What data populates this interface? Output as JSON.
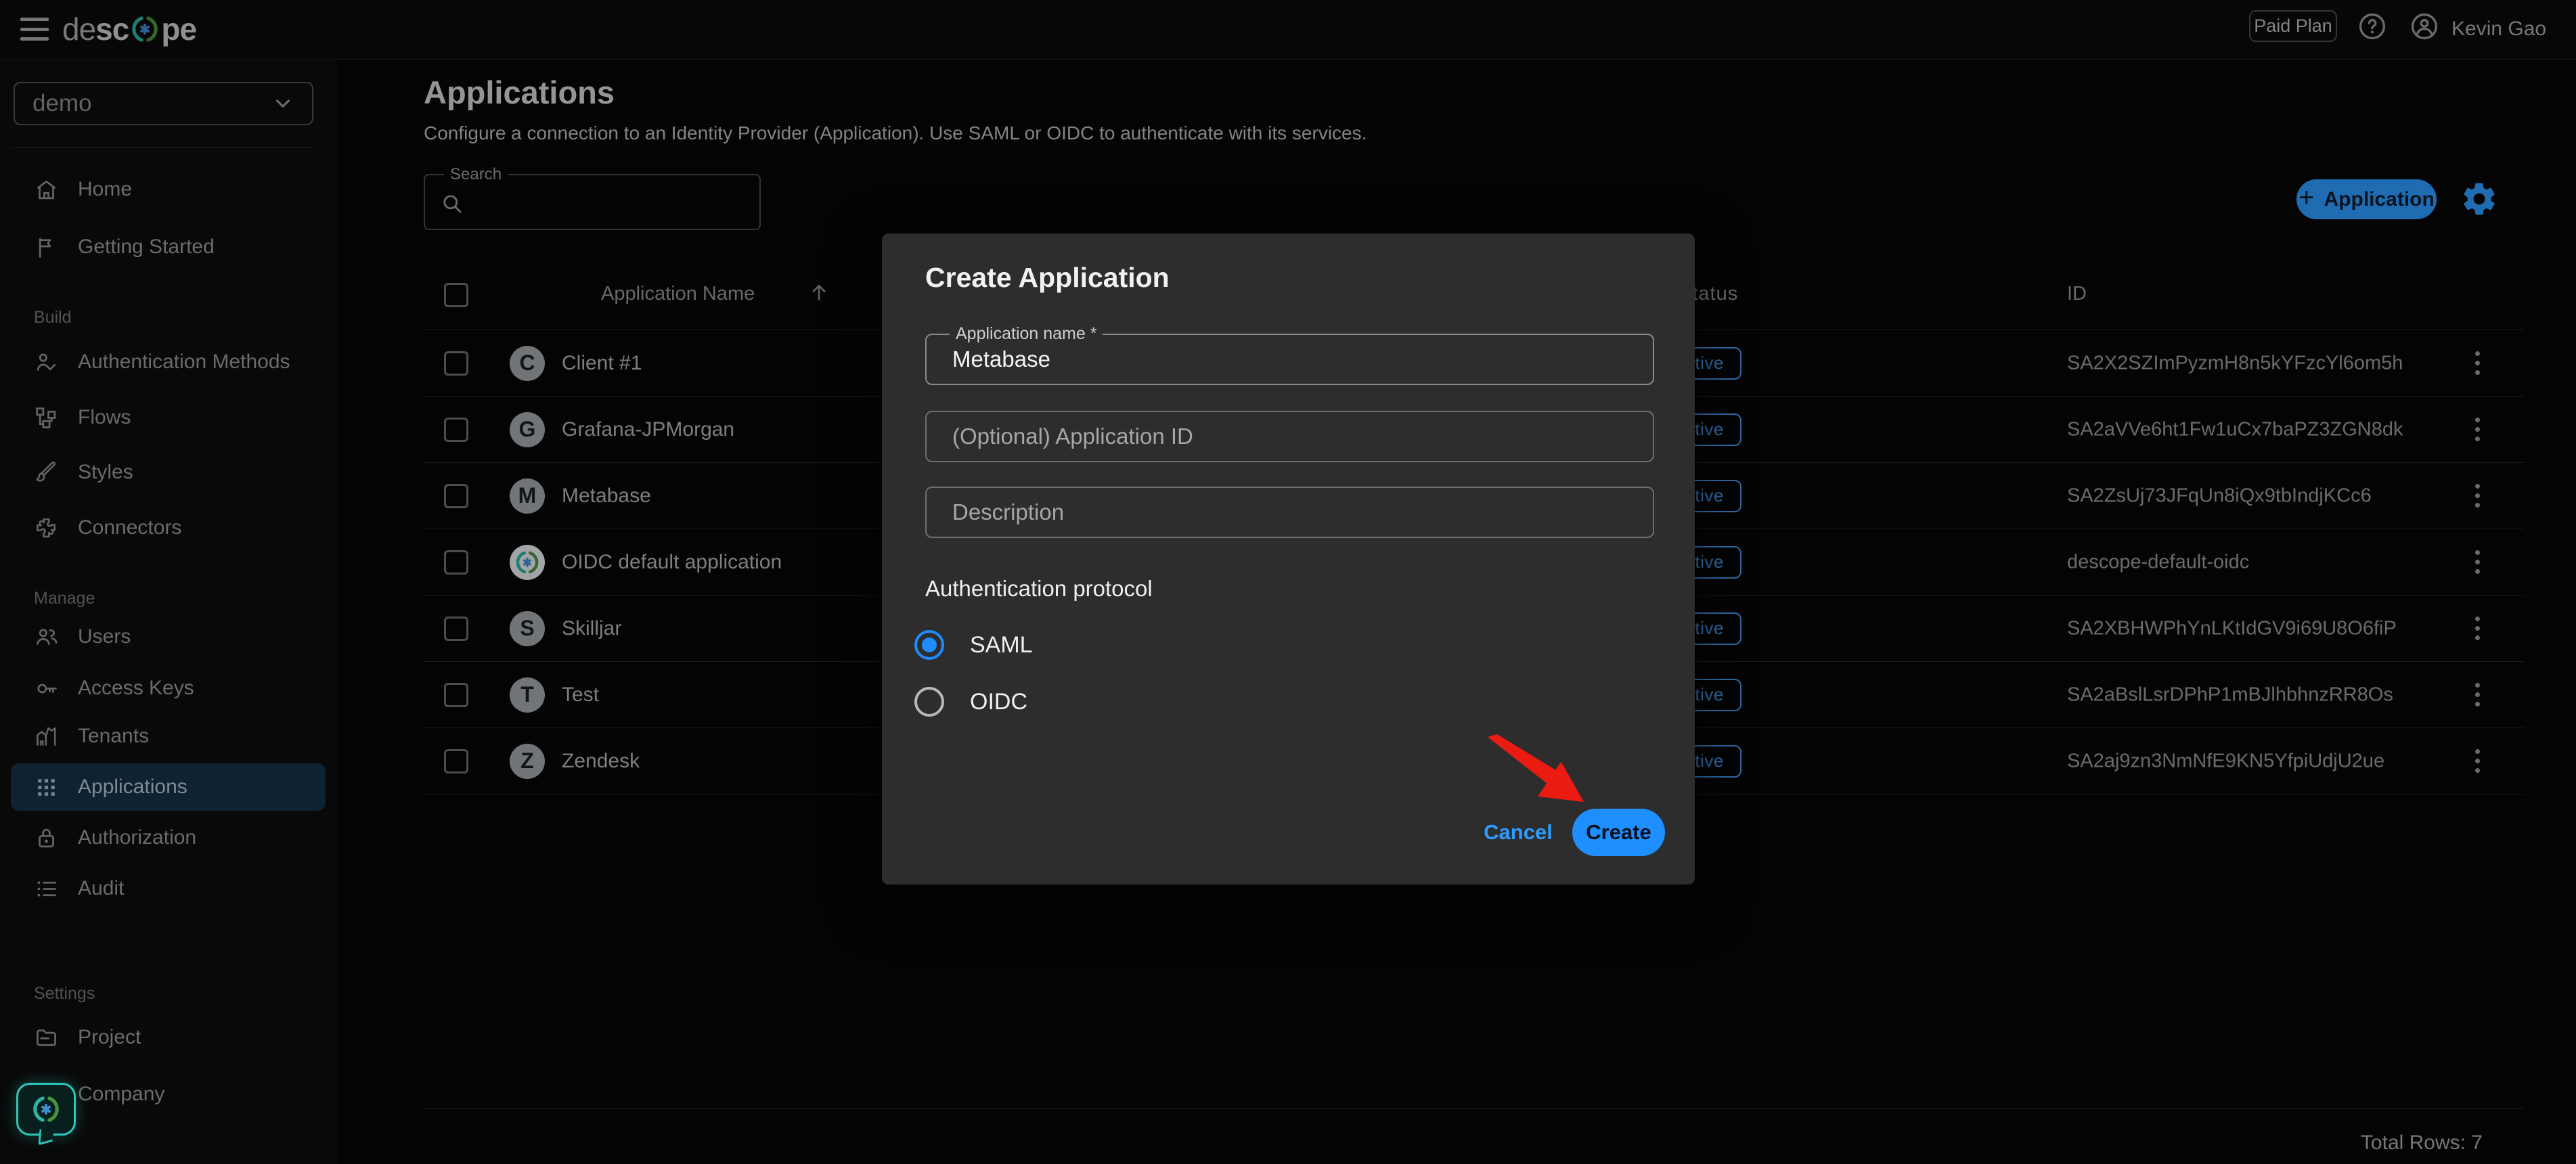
{
  "topbar": {
    "logo_de": "de",
    "logo_sc": "sc",
    "logo_pe": "pe",
    "paid_plan_label": "Paid Plan",
    "user_name": "Kevin Gao"
  },
  "sidebar": {
    "project": "demo",
    "section_build": "Build",
    "section_manage": "Manage",
    "section_settings": "Settings",
    "items": [
      {
        "label": "Home"
      },
      {
        "label": "Getting Started"
      },
      {
        "label": "Authentication Methods"
      },
      {
        "label": "Flows"
      },
      {
        "label": "Styles"
      },
      {
        "label": "Connectors"
      },
      {
        "label": "Users"
      },
      {
        "label": "Access Keys"
      },
      {
        "label": "Tenants"
      },
      {
        "label": "Applications"
      },
      {
        "label": "Authorization"
      },
      {
        "label": "Audit"
      },
      {
        "label": "Project"
      },
      {
        "label": "Company"
      }
    ]
  },
  "page": {
    "title": "Applications",
    "subtitle": "Configure a connection to an Identity Provider (Application). Use SAML or OIDC to authenticate with its services.",
    "search_label": "Search",
    "add_button_label": "Application",
    "add_button_plus": "+",
    "total_rows": "Total Rows: 7"
  },
  "table": {
    "col_name": "Application Name",
    "col_status": "Status",
    "col_id": "ID",
    "rows": [
      {
        "avatar": "C",
        "name": "Client #1",
        "status": "Active",
        "id": "SA2X2SZImPyzmH8n5kYFzcYl6om5h"
      },
      {
        "avatar": "G",
        "name": "Grafana-JPMorgan",
        "status": "Active",
        "id": "SA2aVVe6ht1Fw1uCx7baPZ3ZGN8dk"
      },
      {
        "avatar": "M",
        "name": "Metabase",
        "status": "Active",
        "id": "SA2ZsUj73JFqUn8iQx9tbIndjKCc6"
      },
      {
        "avatar": "",
        "name": "OIDC default application",
        "status": "Active",
        "id": "descope-default-oidc"
      },
      {
        "avatar": "S",
        "name": "Skilljar",
        "status": "Active",
        "id": "SA2XBHWPhYnLKtIdGV9i69U8O6fiP"
      },
      {
        "avatar": "T",
        "name": "Test",
        "status": "Active",
        "id": "SA2aBslLsrDPhP1mBJlhbhnzRR8Os"
      },
      {
        "avatar": "Z",
        "name": "Zendesk",
        "status": "Active",
        "id": "SA2aj9zn3NmNfE9KN5YfpiUdjU2ue"
      }
    ]
  },
  "modal": {
    "title": "Create Application",
    "name_label": "Application name *",
    "name_value": "Metabase",
    "app_id_placeholder": "(Optional) Application ID",
    "description_placeholder": "Description",
    "protocol_label": "Authentication protocol",
    "option_saml": "SAML",
    "option_oidc": "OIDC",
    "selected_protocol": "SAML",
    "cancel_label": "Cancel",
    "create_label": "Create"
  },
  "colors": {
    "accent_blue": "#2e9bff",
    "radio_blue": "#1e8bff",
    "annotation_red": "#ea1c12",
    "brand_teal": "#2cc8bc"
  }
}
